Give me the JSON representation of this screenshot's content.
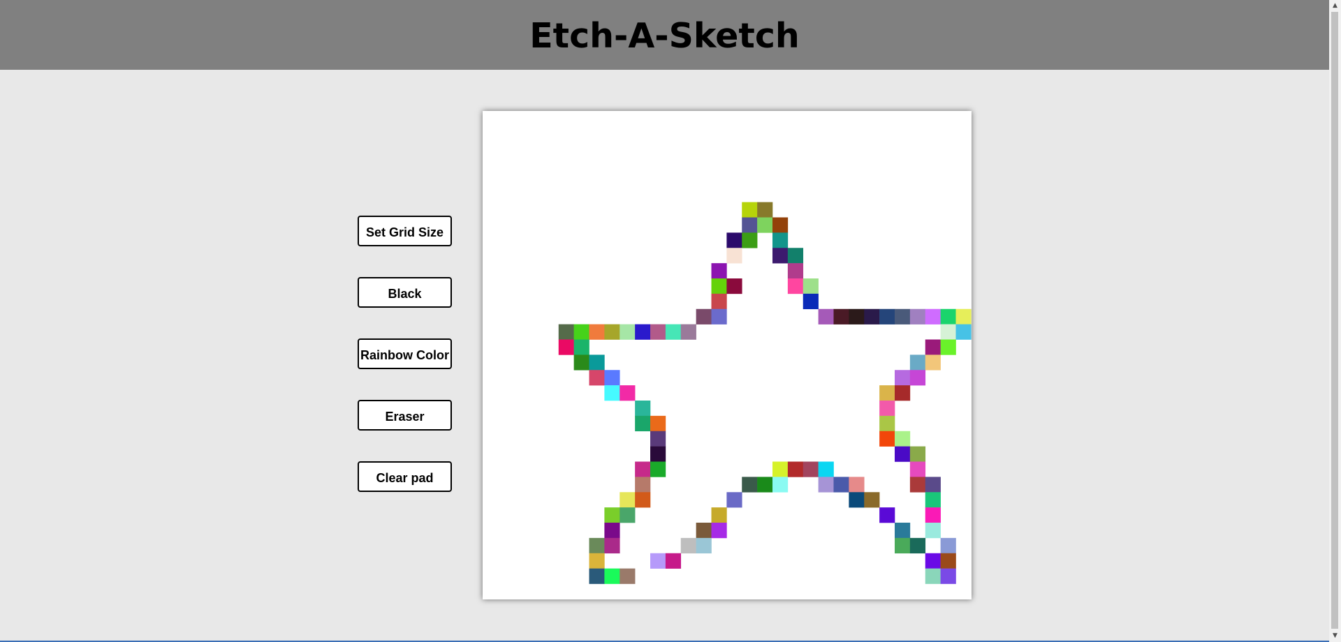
{
  "header": {
    "title": "Etch-A-Sketch"
  },
  "controls": {
    "set_grid_size": "Set Grid Size",
    "black": "Black",
    "rainbow": "Rainbow Color",
    "eraser": "Eraser",
    "clear": "Clear pad"
  },
  "pad": {
    "cells": [
      [
        14,
        3,
        "#b6d40a"
      ],
      [
        15,
        3,
        "#87792a"
      ],
      [
        14,
        4,
        "#545494"
      ],
      [
        15,
        4,
        "#7ed35e"
      ],
      [
        16,
        4,
        "#93420a"
      ],
      [
        13,
        5,
        "#2b0a6b"
      ],
      [
        14,
        5,
        "#3c9e15"
      ],
      [
        16,
        5,
        "#12958b"
      ],
      [
        13,
        6,
        "#f8e2d4"
      ],
      [
        16,
        6,
        "#3c1a6e"
      ],
      [
        17,
        6,
        "#12806b"
      ],
      [
        12,
        7,
        "#8c14b0"
      ],
      [
        17,
        7,
        "#b03c8c"
      ],
      [
        12,
        8,
        "#64d20a"
      ],
      [
        13,
        8,
        "#8a0a3c"
      ],
      [
        17,
        8,
        "#ff46a0"
      ],
      [
        18,
        8,
        "#9ee08a"
      ],
      [
        12,
        9,
        "#c9464c"
      ],
      [
        18,
        9,
        "#0a2ab8"
      ],
      [
        11,
        10,
        "#7a4a6a"
      ],
      [
        12,
        10,
        "#6b6bcc"
      ],
      [
        19,
        10,
        "#a55ab8"
      ],
      [
        20,
        10,
        "#4a1a26"
      ],
      [
        21,
        10,
        "#2b1a1a"
      ],
      [
        22,
        10,
        "#2a1a4a"
      ],
      [
        23,
        10,
        "#25457a"
      ],
      [
        24,
        10,
        "#4a5a7a"
      ],
      [
        25,
        10,
        "#a080c0"
      ],
      [
        26,
        10,
        "#cf6cff"
      ],
      [
        27,
        10,
        "#1ad46c"
      ],
      [
        28,
        10,
        "#e6ee5a"
      ],
      [
        2,
        11,
        "#556b4a"
      ],
      [
        3,
        11,
        "#46d21a"
      ],
      [
        4,
        11,
        "#f07b3c"
      ],
      [
        5,
        11,
        "#a6a62a"
      ],
      [
        6,
        11,
        "#a6e6a6"
      ],
      [
        7,
        11,
        "#2a1acc"
      ],
      [
        8,
        11,
        "#b25a8a"
      ],
      [
        9,
        11,
        "#46e6b6"
      ],
      [
        10,
        11,
        "#9a7a9a"
      ],
      [
        27,
        11,
        "#d6f2d6"
      ],
      [
        28,
        11,
        "#46c2e6"
      ],
      [
        2,
        12,
        "#ea0a64"
      ],
      [
        3,
        12,
        "#1ab46a"
      ],
      [
        26,
        12,
        "#9a1a7a"
      ],
      [
        27,
        12,
        "#6af22a"
      ],
      [
        3,
        13,
        "#2a8a1a"
      ],
      [
        4,
        13,
        "#0a9a9a"
      ],
      [
        25,
        13,
        "#6aaac6"
      ],
      [
        26,
        13,
        "#f2c67a"
      ],
      [
        4,
        14,
        "#d6466a"
      ],
      [
        5,
        14,
        "#5a7aff"
      ],
      [
        24,
        14,
        "#b66ae0"
      ],
      [
        25,
        14,
        "#c646d6"
      ],
      [
        5,
        15,
        "#46faff"
      ],
      [
        6,
        15,
        "#f22aa6"
      ],
      [
        23,
        15,
        "#dab44a"
      ],
      [
        24,
        15,
        "#a62a2a"
      ],
      [
        7,
        16,
        "#2ab69a"
      ],
      [
        23,
        16,
        "#f25aaa"
      ],
      [
        7,
        17,
        "#1aa66a"
      ],
      [
        8,
        17,
        "#ea6a1a"
      ],
      [
        23,
        17,
        "#aac646"
      ],
      [
        8,
        18,
        "#5a3a7a"
      ],
      [
        23,
        18,
        "#f2460a"
      ],
      [
        24,
        18,
        "#aaf28a"
      ],
      [
        8,
        19,
        "#2a0a3a"
      ],
      [
        24,
        19,
        "#4a0ac6"
      ],
      [
        25,
        19,
        "#8aaa4a"
      ],
      [
        7,
        20,
        "#c62a8a"
      ],
      [
        8,
        20,
        "#1aaa2a"
      ],
      [
        16,
        20,
        "#d6f22a"
      ],
      [
        17,
        20,
        "#b22a2a"
      ],
      [
        18,
        20,
        "#a2445e"
      ],
      [
        19,
        20,
        "#0ad6f2"
      ],
      [
        25,
        20,
        "#e64abe"
      ],
      [
        7,
        21,
        "#b67a6a"
      ],
      [
        14,
        21,
        "#3a5a4a"
      ],
      [
        15,
        21,
        "#1a8a1a"
      ],
      [
        16,
        21,
        "#8afaf2"
      ],
      [
        19,
        21,
        "#a694d6"
      ],
      [
        20,
        21,
        "#4a5aaa"
      ],
      [
        21,
        21,
        "#e68a8a"
      ],
      [
        25,
        21,
        "#aa3a3a"
      ],
      [
        26,
        21,
        "#5a4a8a"
      ],
      [
        6,
        22,
        "#e6e65a"
      ],
      [
        7,
        22,
        "#d25a1a"
      ],
      [
        13,
        22,
        "#6a6ac6"
      ],
      [
        21,
        22,
        "#0a4a7a"
      ],
      [
        22,
        22,
        "#8a6a2a"
      ],
      [
        26,
        22,
        "#1ac67a"
      ],
      [
        5,
        23,
        "#7ace2a"
      ],
      [
        6,
        23,
        "#4aa66a"
      ],
      [
        12,
        23,
        "#c6aa2a"
      ],
      [
        23,
        23,
        "#5a0ad6"
      ],
      [
        26,
        23,
        "#fa1ab6"
      ],
      [
        5,
        24,
        "#7a0a8a"
      ],
      [
        11,
        24,
        "#7a5a3a"
      ],
      [
        12,
        24,
        "#a62ae6"
      ],
      [
        24,
        24,
        "#2a7a9a"
      ],
      [
        26,
        24,
        "#9aeade"
      ],
      [
        4,
        25,
        "#6a8a5a"
      ],
      [
        5,
        25,
        "#aa2a8a"
      ],
      [
        10,
        25,
        "#bebebe"
      ],
      [
        11,
        25,
        "#9ac6d6"
      ],
      [
        24,
        25,
        "#4aaa5a"
      ],
      [
        25,
        25,
        "#1a6a5a"
      ],
      [
        27,
        25,
        "#8a9ad6"
      ],
      [
        4,
        26,
        "#dab43a"
      ],
      [
        8,
        26,
        "#b69afa"
      ],
      [
        9,
        26,
        "#c61a8a"
      ],
      [
        26,
        26,
        "#6a0ae6"
      ],
      [
        27,
        26,
        "#9a4a1a"
      ],
      [
        4,
        27,
        "#2a5a7a"
      ],
      [
        5,
        27,
        "#1afa5a"
      ],
      [
        6,
        27,
        "#9a7a6a"
      ],
      [
        26,
        27,
        "#8ad6ba"
      ],
      [
        27,
        27,
        "#7a4ae6"
      ]
    ]
  }
}
